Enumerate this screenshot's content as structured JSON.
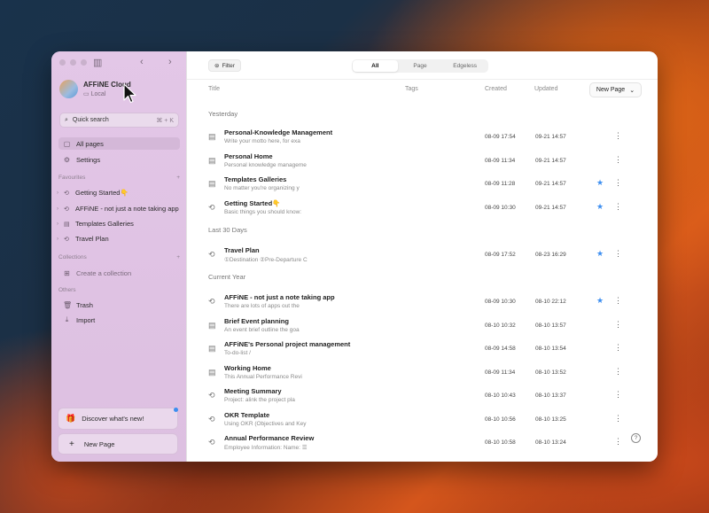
{
  "workspace": {
    "name": "AFFiNE Cloud",
    "storage": "Local"
  },
  "search": {
    "label": "Quick search",
    "shortcut": "⌘ + K"
  },
  "nav": [
    {
      "icon": "grid-icon",
      "label": "All pages"
    },
    {
      "icon": "gear-icon",
      "label": "Settings"
    }
  ],
  "favourites": {
    "label": "Favourites",
    "items": [
      {
        "icon": "edgeless-icon",
        "label": "Getting Started👇"
      },
      {
        "icon": "edgeless-icon",
        "label": "AFFiNE - not just a note taking app"
      },
      {
        "icon": "page-icon",
        "label": "Templates Galleries"
      },
      {
        "icon": "edgeless-icon",
        "label": "Travel Plan"
      }
    ]
  },
  "collections": {
    "label": "Collections",
    "create_label": "Create a collection"
  },
  "others": {
    "label": "Others",
    "items": [
      {
        "icon": "trash-icon",
        "label": "Trash"
      },
      {
        "icon": "import-icon",
        "label": "Import"
      }
    ]
  },
  "discover": {
    "label": "Discover what's new!"
  },
  "new_page": {
    "label": "New Page"
  },
  "toolbar": {
    "filter_label": "Filter",
    "tabs": [
      "All",
      "Page",
      "Edgeless"
    ],
    "active_tab": "All",
    "new_page_label": "New Page"
  },
  "columns": {
    "title": "Title",
    "tags": "Tags",
    "created": "Created",
    "updated": "Updated"
  },
  "groups": [
    {
      "label": "Yesterday",
      "rows": [
        {
          "icon": "page-icon",
          "title": "Personal-Knowledge Management",
          "subtitle": "Write your motto here, for exa",
          "created": "08-09 17:54",
          "updated": "09-21 14:57",
          "favorite": false
        },
        {
          "icon": "page-icon",
          "title": "Personal Home",
          "subtitle": "Personal knowledge manageme",
          "created": "08-09 11:34",
          "updated": "09-21 14:57",
          "favorite": false
        },
        {
          "icon": "page-icon",
          "title": "Templates Galleries",
          "subtitle": "No matter you're organizing y",
          "created": "08-09 11:28",
          "updated": "09-21 14:57",
          "favorite": true
        },
        {
          "icon": "edgeless-icon",
          "title": "Getting Started👇",
          "subtitle": "Basic things you should know:",
          "created": "08-09 10:30",
          "updated": "09-21 14:57",
          "favorite": true
        }
      ]
    },
    {
      "label": "Last 30 Days",
      "rows": [
        {
          "icon": "edgeless-icon",
          "title": "Travel Plan",
          "subtitle": "①Destination ②Pre-Departure C",
          "created": "08-09 17:52",
          "updated": "08-23 16:29",
          "favorite": true
        }
      ]
    },
    {
      "label": "Current Year",
      "rows": [
        {
          "icon": "edgeless-icon",
          "title": "AFFiNE - not just a note taking app",
          "subtitle": "There are lots of apps out the",
          "created": "08-09 10:30",
          "updated": "08-10 22:12",
          "favorite": true
        },
        {
          "icon": "page-icon",
          "title": "Brief Event planning",
          "subtitle": "An event brief outline the goa",
          "created": "08-10 10:32",
          "updated": "08-10 13:57",
          "favorite": false
        },
        {
          "icon": "page-icon",
          "title": "AFFiNE's Personal project management",
          "subtitle": "To-do-list /",
          "created": "08-09 14:58",
          "updated": "08-10 13:54",
          "favorite": false
        },
        {
          "icon": "page-icon",
          "title": "Working Home",
          "subtitle": "This Annual Performance Revi",
          "created": "08-09 11:34",
          "updated": "08-10 13:52",
          "favorite": false
        },
        {
          "icon": "edgeless-icon",
          "title": "Meeting Summary",
          "subtitle": "Project: alink the project pla",
          "created": "08-10 10:43",
          "updated": "08-10 13:37",
          "favorite": false
        },
        {
          "icon": "edgeless-icon",
          "title": "OKR Template",
          "subtitle": "Using OKR (Objectives and Key",
          "created": "08-10 10:56",
          "updated": "08-10 13:25",
          "favorite": false
        },
        {
          "icon": "edgeless-icon",
          "title": "Annual Performance Review",
          "subtitle": "Employee Information: Name: ☰",
          "created": "08-10 10:58",
          "updated": "08-10 13:24",
          "favorite": false
        }
      ]
    }
  ],
  "colors": {
    "accent": "#3c8ef0",
    "sidebar": "#e3c6e6",
    "star": "#3c8ef0"
  }
}
